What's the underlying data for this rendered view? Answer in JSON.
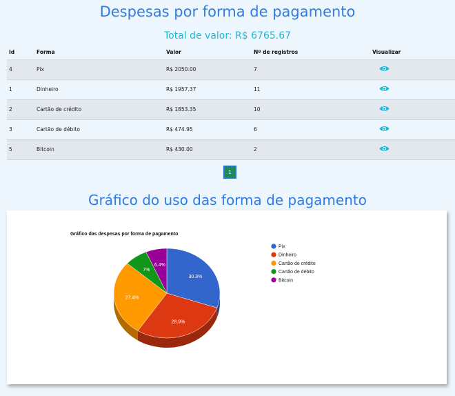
{
  "header": {
    "title": "Despesas por forma de pagamento",
    "total": "Total de valor: R$ 6765.67"
  },
  "table": {
    "columns": [
      "Id",
      "Forma",
      "Valor",
      "Nº de registros",
      "Visualizar"
    ],
    "rows": [
      {
        "id": "4",
        "forma": "Pix",
        "valor": "R$ 2050.00",
        "registros": "7",
        "icon": "eye-icon"
      },
      {
        "id": "1",
        "forma": "Dinheiro",
        "valor": "R$ 1957.37",
        "registros": "11",
        "icon": "eye-icon"
      },
      {
        "id": "2",
        "forma": "Cartão de crédito",
        "valor": "R$ 1853.35",
        "registros": "10",
        "icon": "eye-icon"
      },
      {
        "id": "3",
        "forma": "Cartão de débito",
        "valor": "R$ 474.95",
        "registros": "6",
        "icon": "eye-icon"
      },
      {
        "id": "5",
        "forma": "Bitcoin",
        "valor": "R$ 430.00",
        "registros": "2",
        "icon": "eye-icon"
      }
    ]
  },
  "pagination": {
    "current": "1"
  },
  "chart_section": {
    "heading": "Gráfico do uso das forma de pagamento"
  },
  "chart_data": {
    "type": "pie",
    "title": "Gráfico das despesas por forma de pagamento",
    "categories": [
      "Pix",
      "Dinheiro",
      "Cartão de crédito",
      "Cartão de débito",
      "Bitcoin"
    ],
    "values": [
      30.3,
      28.9,
      27.4,
      7.0,
      6.4
    ],
    "labels": [
      "30.3%",
      "28.9%",
      "27.4%",
      "7%",
      "6.4%"
    ],
    "colors": [
      "#3366cc",
      "#dc3912",
      "#ff9900",
      "#109618",
      "#990099"
    ],
    "legend_position": "right",
    "style": "3d"
  },
  "colors": {
    "accent": "#2f7de1",
    "total": "#1fb8d8",
    "eye": "#1fb8d8"
  }
}
